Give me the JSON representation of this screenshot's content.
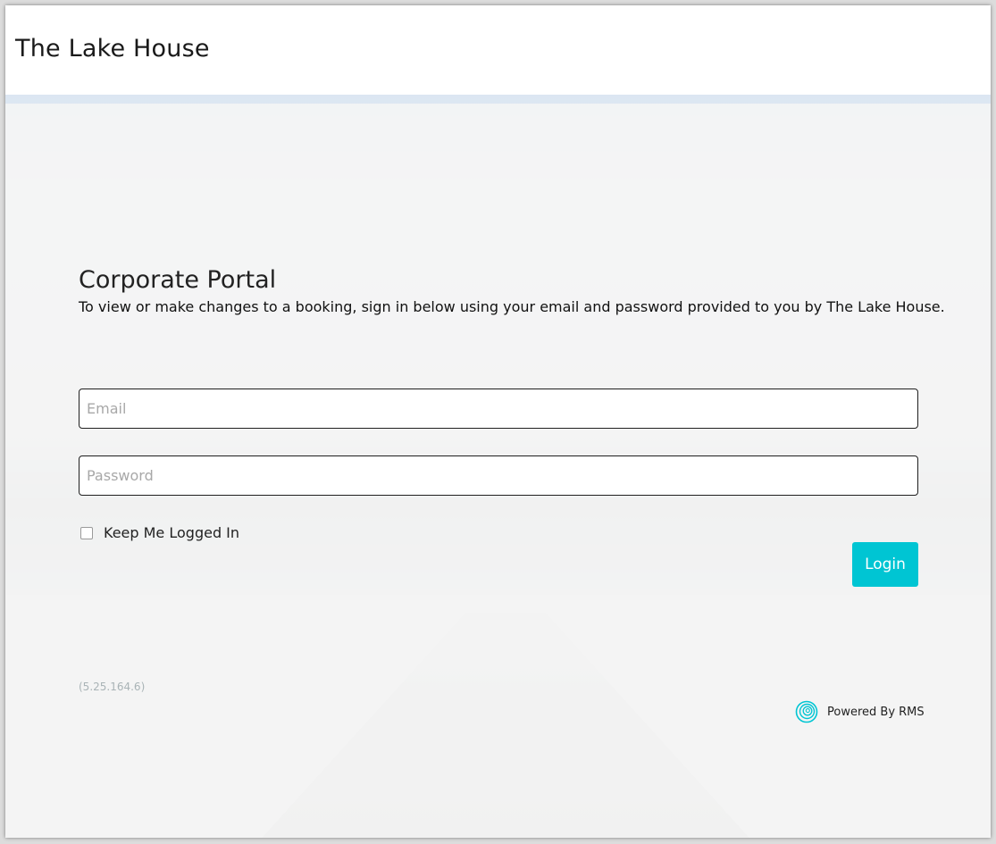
{
  "header": {
    "title": "The Lake House"
  },
  "portal": {
    "title": "Corporate Portal",
    "description": "To view or make changes to a booking, sign in below using your email and password provided to you by The Lake House."
  },
  "form": {
    "email_placeholder": "Email",
    "password_placeholder": "Password",
    "keep_logged_in_label": "Keep Me Logged In",
    "keep_logged_in_checked": false,
    "login_label": "Login"
  },
  "footer": {
    "version": "(5.25.164.6)",
    "powered_by": "Powered By RMS",
    "rms_icon": "rms-logo-icon"
  },
  "colors": {
    "accent": "#00c5d3",
    "version_text": "#a9b3b6"
  }
}
